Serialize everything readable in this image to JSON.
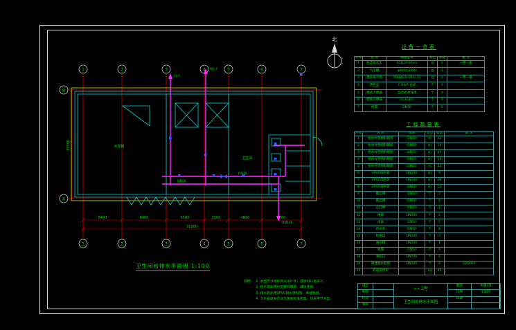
{
  "colors": {
    "axis_red": "#d40000",
    "wall_cyan": "#00d8d8",
    "pipe_magenta": "#ff2bff",
    "outline_yellow": "#e8e800",
    "text_green": "#00e000",
    "valve_blue": "#3a5cff"
  },
  "north": {
    "label": "北"
  },
  "plan": {
    "title": "卫生间给排水平面图 1:100",
    "axes": {
      "cols": [
        "1",
        "2",
        "3",
        "4",
        "5",
        "6",
        "7"
      ],
      "rows": [
        "B",
        "A"
      ]
    },
    "dims": {
      "bottom": [
        "5400",
        "6400",
        "5500",
        "3500",
        "4800",
        "5700"
      ],
      "bottom_total": "31300",
      "left": "15500"
    },
    "labels": {
      "riser1": "JL-1",
      "riser2": "WL-1",
      "pipe_dn100": "DN100",
      "pipe_dn70": "DN70",
      "pipe_dn50": "DN50",
      "room_pump": "水泵房",
      "room_toilet": "卫生间"
    }
  },
  "tables": {
    "equipment": {
      "title": "设备一览表",
      "headers": [
        "序号",
        "名 称",
        "规格型号",
        "单位",
        "数量",
        "备 注"
      ],
      "rows": [
        [
          "1",
          "生活给水泵",
          "25LG3-10×3",
          "台",
          "2",
          "一用一备"
        ],
        [
          "2",
          "气压罐",
          "φ800×2000",
          "台",
          "1",
          ""
        ],
        [
          "3",
          "潜水排污泵",
          "50QW10-10-0.75",
          "台",
          "2",
          "一用一备"
        ],
        [
          "4",
          "洗脸盆",
          "C-64/A 台式",
          "个",
          "4",
          ""
        ],
        [
          "5",
          "蹲式大便器",
          "自闭式冲洗阀",
          "个",
          "8",
          ""
        ],
        [
          "6",
          "挂式小便器",
          "h=0.8m",
          "个",
          "4",
          ""
        ],
        [
          "7",
          "地漏",
          "DN50",
          "个",
          "6",
          ""
        ]
      ]
    },
    "quantity": {
      "title": "工程数量表",
      "headers": [
        "序号",
        "名 称",
        "规格",
        "单位",
        "数量",
        "备 注"
      ],
      "rows": [
        [
          "1",
          "给水衬塑镀锌钢管",
          "DN70",
          "m",
          "12",
          ""
        ],
        [
          "2",
          "给水衬塑镀锌钢管",
          "DN50",
          "m",
          "16",
          ""
        ],
        [
          "3",
          "给水衬塑镀锌钢管",
          "DN32",
          "m",
          "10",
          ""
        ],
        [
          "4",
          "给水衬塑镀锌钢管",
          "DN25",
          "m",
          "14",
          ""
        ],
        [
          "5",
          "给水衬塑镀锌钢管",
          "DN15",
          "m",
          "22",
          ""
        ],
        [
          "6",
          "UPVC排水管",
          "DN150",
          "m",
          "9",
          ""
        ],
        [
          "7",
          "UPVC排水管",
          "DN100",
          "m",
          "26",
          ""
        ],
        [
          "8",
          "UPVC排水管",
          "DN50",
          "m",
          "12",
          ""
        ],
        [
          "9",
          "截止阀",
          "DN70",
          "个",
          "2",
          ""
        ],
        [
          "10",
          "截止阀",
          "DN50",
          "个",
          "4",
          ""
        ],
        [
          "11",
          "止回阀",
          "DN70",
          "个",
          "1",
          ""
        ],
        [
          "12",
          "闸阀",
          "DN100",
          "个",
          "2",
          ""
        ],
        [
          "13",
          "水表",
          "DN50",
          "个",
          "1",
          ""
        ],
        [
          "14",
          "存水弯",
          "DN50",
          "个",
          "8",
          ""
        ],
        [
          "15",
          "检查口",
          "DN100",
          "个",
          "3",
          ""
        ],
        [
          "16",
          "通气帽",
          "DN100",
          "个",
          "1",
          ""
        ],
        [
          "17",
          "地漏",
          "DN50",
          "个",
          "6",
          ""
        ],
        [
          "18",
          "清扫口",
          "DN100",
          "个",
          "2",
          ""
        ],
        [
          "19",
          "刚性防水套管",
          "DN100",
          "个",
          "4",
          "02S404"
        ],
        [
          "20",
          "管道支吊架",
          "",
          "kg",
          "45",
          ""
        ]
      ]
    }
  },
  "notes": {
    "heading": "说明：",
    "items": [
      "1. 本图尺寸除标高以米计外，其余均以毫米计。",
      "2. 给水管采用衬塑镀锌钢管，螺纹连接。",
      "3. 排水管采用UPVC排水塑料管，承插粘接。",
      "4. 卫生器具安装详见国家标准图集，均采用节水型。"
    ]
  },
  "titleblock": {
    "design_label": "设计",
    "draft_label": "制图",
    "check_label": "校对",
    "approve_label": "审核",
    "project_name": "××工程",
    "drawing_name": "卫生间给排水平面图",
    "no_label": "图号",
    "no_value": "水施-01",
    "scale_label": "比例",
    "scale_value": "1:100",
    "date_label": "日期",
    "date_value": ""
  }
}
